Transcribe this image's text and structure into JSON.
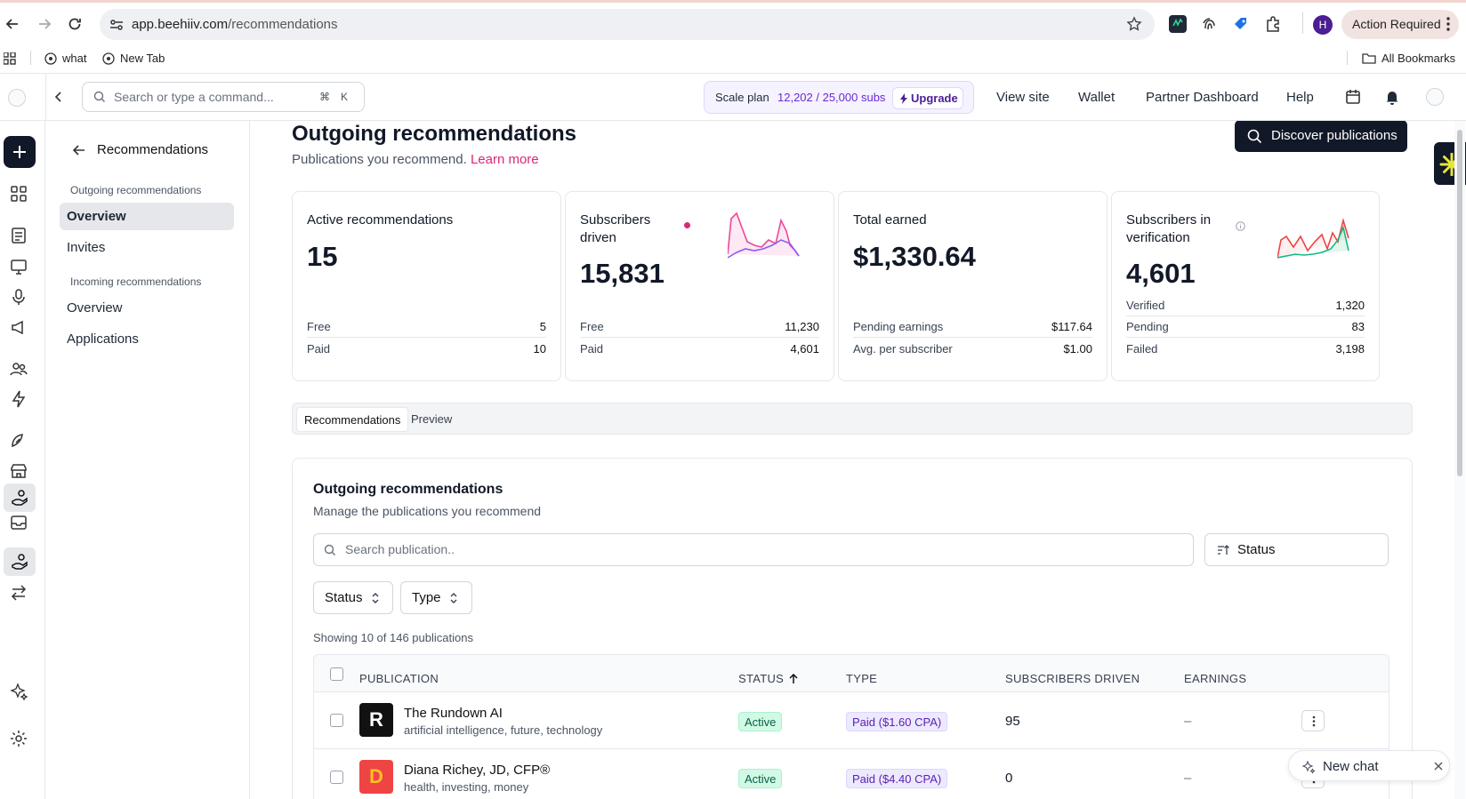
{
  "browser": {
    "url_host": "app.beehiiv.com",
    "url_path": "/recommendations",
    "action_required": "Action Required",
    "avatar_letter": "H",
    "bookmarks": [
      "what",
      "New Tab"
    ],
    "all_bookmarks": "All Bookmarks"
  },
  "header": {
    "search_placeholder": "Search or type a command...",
    "kbd_cmd": "⌘",
    "kbd_k": "K",
    "plan_label": "Scale plan",
    "plan_usage": "12,202 / 25,000 subs",
    "upgrade": "Upgrade",
    "links": [
      "View site",
      "Wallet",
      "Partner Dashboard",
      "Help"
    ]
  },
  "subnav": {
    "back_label": "Recommendations",
    "outgoing_group": "Outgoing recommendations",
    "outgoing_items": [
      "Overview",
      "Invites"
    ],
    "incoming_group": "Incoming recommendations",
    "incoming_items": [
      "Overview",
      "Applications"
    ]
  },
  "page": {
    "title": "Outgoing recommendations",
    "subtitle": "Publications you recommend.",
    "learn_more": "Learn more",
    "discover_button": "Discover publications"
  },
  "cards": {
    "active": {
      "title": "Active recommendations",
      "value": "15",
      "rows": [
        {
          "label": "Free",
          "value": "5"
        },
        {
          "label": "Paid",
          "value": "10"
        }
      ]
    },
    "driven": {
      "title": "Subscribers driven",
      "value": "15,831",
      "rows": [
        {
          "label": "Free",
          "value": "11,230"
        },
        {
          "label": "Paid",
          "value": "4,601"
        }
      ]
    },
    "earned": {
      "title": "Total earned",
      "value": "$1,330.64",
      "rows": [
        {
          "label": "Pending earnings",
          "value": "$117.64"
        },
        {
          "label": "Avg. per subscriber",
          "value": "$1.00"
        }
      ]
    },
    "verification": {
      "title": "Subscribers in verification",
      "value": "4,601",
      "rows": [
        {
          "label": "Verified",
          "value": "1,320"
        },
        {
          "label": "Pending",
          "value": "83"
        },
        {
          "label": "Failed",
          "value": "3,198"
        }
      ]
    }
  },
  "tabs": [
    "Recommendations",
    "Preview"
  ],
  "panel": {
    "title": "Outgoing recommendations",
    "subtitle": "Manage the publications you recommend",
    "search_placeholder": "Search publication..",
    "sort_label": "Status",
    "filter_status": "Status",
    "filter_type": "Type",
    "showing": "Showing 10 of 146 publications",
    "columns": [
      "PUBLICATION",
      "STATUS",
      "TYPE",
      "SUBSCRIBERS DRIVEN",
      "EARNINGS"
    ],
    "rows": [
      {
        "name": "The Rundown AI",
        "tags": "artificial intelligence, future, technology",
        "status": "Active",
        "type": "Paid ($1.60 CPA)",
        "driven": "95",
        "earnings": "–"
      },
      {
        "name": "Diana Richey, JD, CFP®",
        "tags": "health, investing, money",
        "status": "Active",
        "type": "Paid ($4.40 CPA)",
        "driven": "0",
        "earnings": "–"
      }
    ]
  },
  "chat": {
    "new_chat": "New chat"
  },
  "colors": {
    "accent_pink": "#db2777",
    "dark": "#111827",
    "active_green": "#065f46",
    "paid_purple": "#5b21b6",
    "action_required_bg": "#f1e4e0",
    "ext_badge": "#e8e537"
  }
}
